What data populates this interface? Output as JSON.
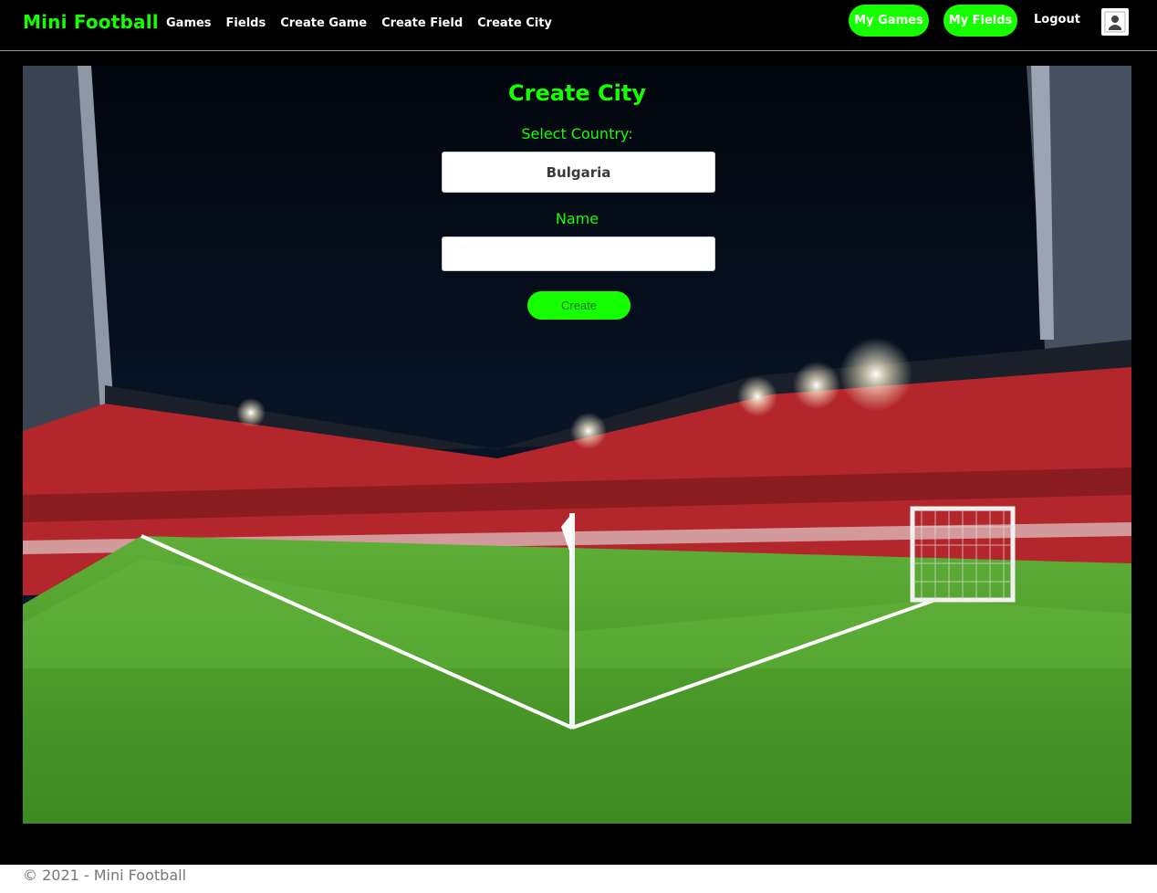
{
  "nav": {
    "brand": "Mini Football",
    "links": [
      "Games",
      "Fields",
      "Create Game",
      "Create Field",
      "Create City"
    ],
    "my_games": "My Games",
    "my_fields": "My Fields",
    "logout": "Logout",
    "profile_icon": "user-profile-icon"
  },
  "form": {
    "title": "Create City",
    "country_label": "Select Country:",
    "country_value": "Bulgaria",
    "name_label": "Name",
    "name_value": "",
    "submit_label": "Create"
  },
  "background": {
    "image_subject": "stadium-photo"
  },
  "footer": {
    "text": "© 2021 - Mini Football"
  },
  "colors": {
    "accent": "#16ff00",
    "navbar": "#000000",
    "footer_text": "#777777"
  }
}
